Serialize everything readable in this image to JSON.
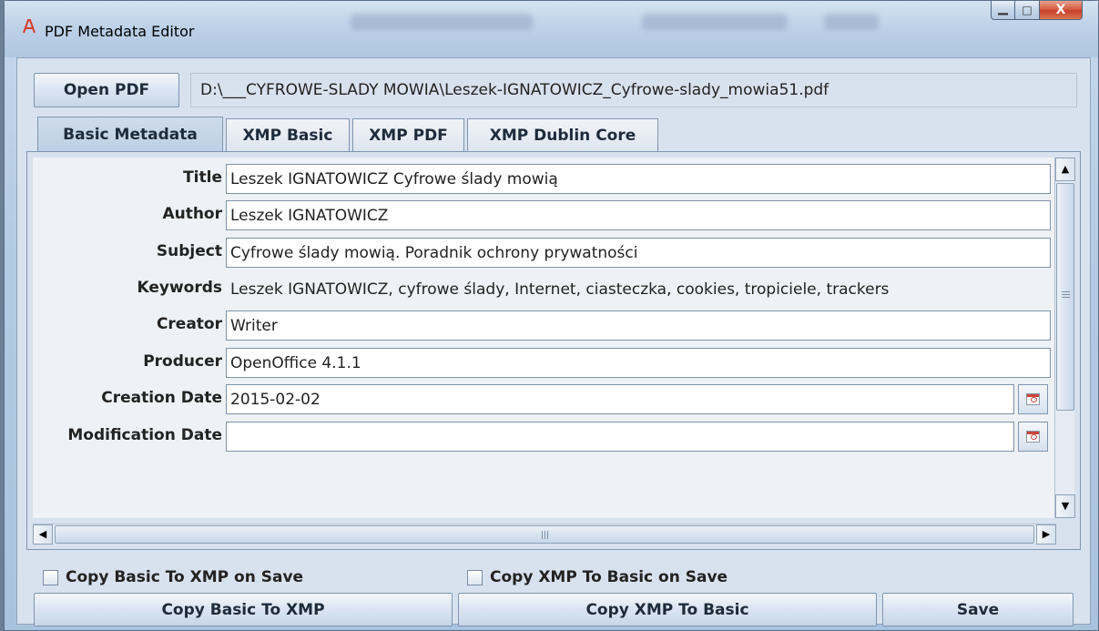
{
  "window": {
    "title": "PDF Metadata Editor",
    "minimize_glyph": "▁",
    "maximize_glyph": "□",
    "close_glyph": "X"
  },
  "toolbar": {
    "open_label": "Open PDF",
    "file_path": "D:\\___CYFROWE-SLADY MOWIA\\Leszek-IGNATOWICZ_Cyfrowe-slady_mowia51.pdf"
  },
  "tabs": [
    {
      "label": "Basic Metadata",
      "active": true
    },
    {
      "label": "XMP Basic",
      "active": false
    },
    {
      "label": "XMP PDF",
      "active": false
    },
    {
      "label": "XMP Dublin Core",
      "active": false
    }
  ],
  "fields": {
    "title": {
      "label": "Title",
      "value": "Leszek IGNATOWICZ Cyfrowe ślady mowią"
    },
    "author": {
      "label": "Author",
      "value": "Leszek IGNATOWICZ"
    },
    "subject": {
      "label": "Subject",
      "value": "Cyfrowe ślady mowią. Poradnik ochrony prywatności"
    },
    "keywords": {
      "label": "Keywords",
      "value": "Leszek IGNATOWICZ, cyfrowe ślady, Internet, ciasteczka, cookies, tropiciele, trackers"
    },
    "creator": {
      "label": "Creator",
      "value": "Writer"
    },
    "producer": {
      "label": "Producer",
      "value": "OpenOffice 4.1.1"
    },
    "creation_date": {
      "label": "Creation Date",
      "value": "2015-02-02"
    },
    "modification_date": {
      "label": "Modification Date",
      "value": ""
    }
  },
  "options": {
    "copy_basic_on_save": {
      "label": "Copy Basic To XMP on Save",
      "checked": false
    },
    "copy_xmp_on_save": {
      "label": "Copy XMP To Basic on Save",
      "checked": false
    }
  },
  "actions": {
    "copy_basic_to_xmp": "Copy Basic To XMP",
    "copy_xmp_to_basic": "Copy XMP To Basic",
    "save": "Save"
  },
  "icons": {
    "app": "pdf-icon",
    "calendar": "calendar-icon",
    "scroll_up": "▲",
    "scroll_down": "▼",
    "scroll_left": "◀",
    "scroll_right": "▶"
  },
  "colors": {
    "accent": "#c7402a",
    "panel": "#d8e2ee"
  }
}
